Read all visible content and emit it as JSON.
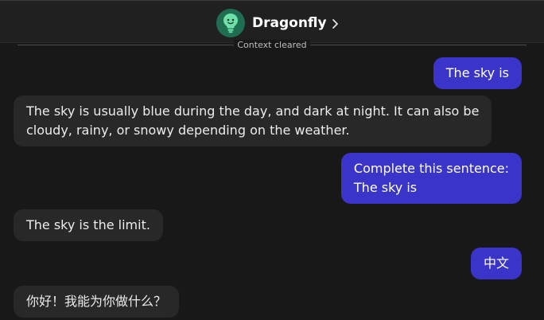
{
  "header": {
    "bot_name": "Dragonfly"
  },
  "divider": {
    "label": "Context cleared"
  },
  "messages": [
    {
      "role": "user",
      "lines": [
        "The sky is"
      ]
    },
    {
      "role": "bot",
      "lines": [
        "The sky is usually blue during the day, and dark at night. It can also be",
        "cloudy, rainy, or snowy depending on the weather."
      ]
    },
    {
      "role": "user",
      "lines": [
        "Complete this sentence:",
        "The sky is"
      ]
    },
    {
      "role": "bot",
      "lines": [
        "The sky is the limit."
      ]
    },
    {
      "role": "user",
      "lines": [
        "中文"
      ]
    },
    {
      "role": "bot",
      "lines": [
        "你好！我能为你做什么？"
      ]
    }
  ],
  "colors": {
    "user_bubble": "#3a35c8",
    "bot_bubble": "#282828",
    "background": "#181818",
    "avatar": "#1f6e52"
  },
  "icons": {
    "avatar": "lightbulb-face-icon",
    "chevron": "chevron-right-icon"
  }
}
